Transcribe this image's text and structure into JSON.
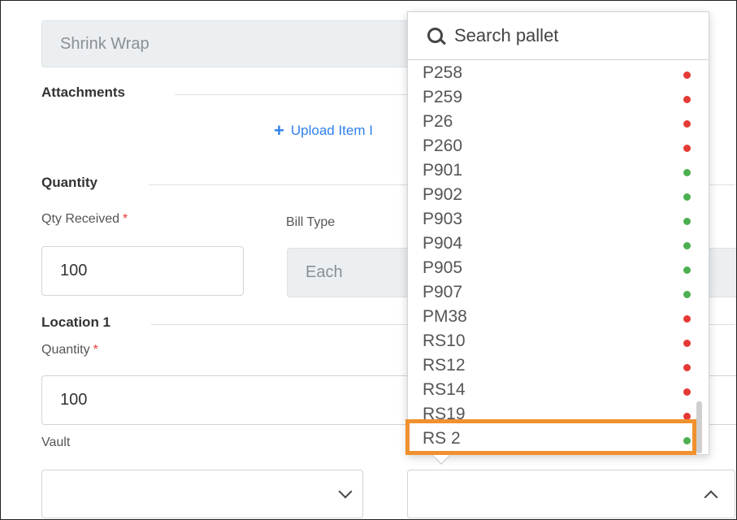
{
  "shrink_wrap": {
    "value": "Shrink Wrap"
  },
  "attachments": {
    "title": "Attachments",
    "upload_label": "Upload Item I"
  },
  "quantity": {
    "title": "Quantity",
    "qty_received_label": "Qty Received",
    "required_mark": "*",
    "qty_received_value": "100",
    "bill_type_label": "Bill Type",
    "bill_type_value": "Each"
  },
  "location": {
    "title": "Location 1",
    "quantity_label": "Quantity",
    "quantity_value": "100",
    "vault_label": "Vault",
    "vault_value": "",
    "pallet_value": ""
  },
  "pallet_dropdown": {
    "search_placeholder": "Search pallet",
    "items": [
      {
        "label": "P258",
        "status_color": "#e53935"
      },
      {
        "label": "P259",
        "status_color": "#e53935"
      },
      {
        "label": "P26",
        "status_color": "#e53935"
      },
      {
        "label": "P260",
        "status_color": "#e53935"
      },
      {
        "label": "P901",
        "status_color": "#4caf50"
      },
      {
        "label": "P902",
        "status_color": "#4caf50"
      },
      {
        "label": "P903",
        "status_color": "#4caf50"
      },
      {
        "label": "P904",
        "status_color": "#4caf50"
      },
      {
        "label": "P905",
        "status_color": "#4caf50"
      },
      {
        "label": "P907",
        "status_color": "#4caf50"
      },
      {
        "label": "PM38",
        "status_color": "#e53935"
      },
      {
        "label": "RS10",
        "status_color": "#e53935"
      },
      {
        "label": "RS12",
        "status_color": "#e53935"
      },
      {
        "label": "RS14",
        "status_color": "#e53935"
      },
      {
        "label": "RS19",
        "status_color": "#e53935"
      },
      {
        "label": "RS 2",
        "status_color": "#4caf50"
      }
    ],
    "highlight_color": "#f0912f"
  }
}
